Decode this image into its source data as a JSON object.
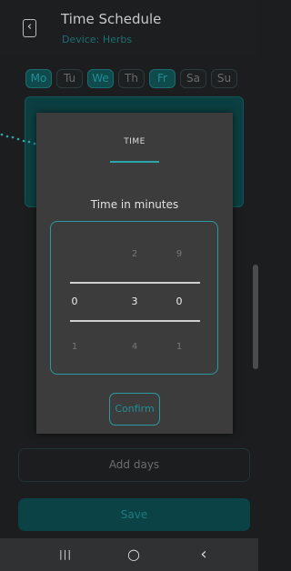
{
  "header": {
    "title": "Time Schedule",
    "subtitle": "Device: Herbs",
    "back_icon": "‹"
  },
  "days": [
    {
      "label": "Mo",
      "active": true
    },
    {
      "label": "Tu",
      "active": false
    },
    {
      "label": "We",
      "active": true
    },
    {
      "label": "Th",
      "active": false
    },
    {
      "label": "Fr",
      "active": true
    },
    {
      "label": "Sa",
      "active": false
    },
    {
      "label": "Su",
      "active": false
    }
  ],
  "modal": {
    "title": "TIME",
    "subtitle": "Time in minutes",
    "picker": {
      "above": [
        "",
        "2",
        "9"
      ],
      "selected": [
        "0",
        "3",
        "0"
      ],
      "below": [
        "1",
        "4",
        "1"
      ]
    },
    "confirm_label": "Confirm"
  },
  "add_days_label": "Add days",
  "save_label": "Save",
  "navbar": {
    "recents_icon": "|||",
    "home_icon": "○",
    "back_icon": "‹"
  },
  "colors": {
    "accent": "#2aa7ad",
    "active_day_bg": "#0f4a4d",
    "modal_bg": "#3c3c3c"
  }
}
